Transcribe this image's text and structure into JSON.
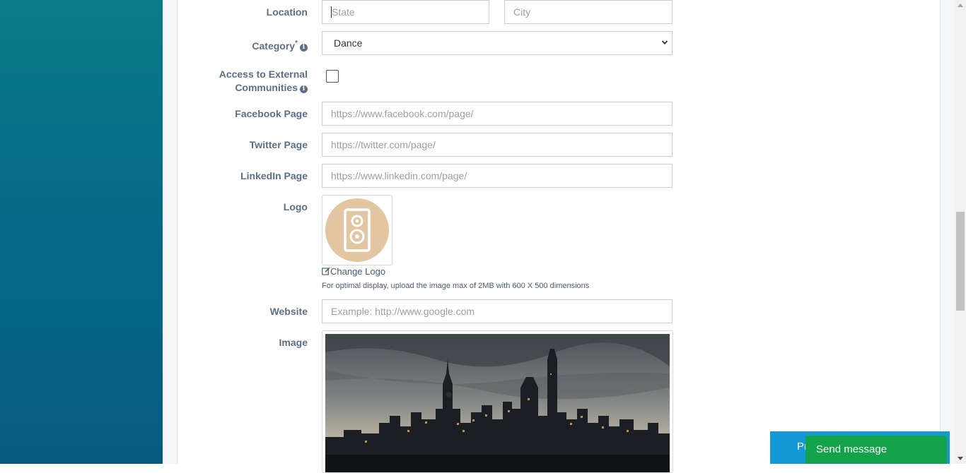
{
  "form": {
    "location": {
      "label": "Location",
      "state_placeholder": "State",
      "city_placeholder": "City"
    },
    "category": {
      "label": "Category",
      "required_mark": "*",
      "selected": "Dance"
    },
    "external_access": {
      "label_line1": "Access to External",
      "label_line2": "Communities",
      "checked": false
    },
    "facebook": {
      "label": "Facebook Page",
      "placeholder": "https://www.facebook.com/page/"
    },
    "twitter": {
      "label": "Twitter Page",
      "placeholder": "https://twitter.com/page/"
    },
    "linkedin": {
      "label": "LinkedIn Page",
      "placeholder": "https://www.linkedin.com/page/"
    },
    "logo": {
      "label": "Logo",
      "change_label": "Change Logo",
      "hint": "For optimal display, upload the image max of 2MB with 600 X 500 dimensions",
      "circle_color": "#e2c6a2"
    },
    "website": {
      "label": "Website",
      "placeholder": "Example: http://www.google.com"
    },
    "image": {
      "label": "Image"
    }
  },
  "footer_buttons": {
    "blue_partial_label": "Pr",
    "send_message": "Send message"
  },
  "colors": {
    "sidebar_gradient_top": "#0a7a88",
    "sidebar_gradient_bottom": "#075a82",
    "label_text": "#5c6f86",
    "blue_button": "#139ad6",
    "green_button": "#13a34a"
  },
  "icons": [
    "info-icon",
    "edit-icon",
    "speaker-icon",
    "chevron-down-icon"
  ]
}
